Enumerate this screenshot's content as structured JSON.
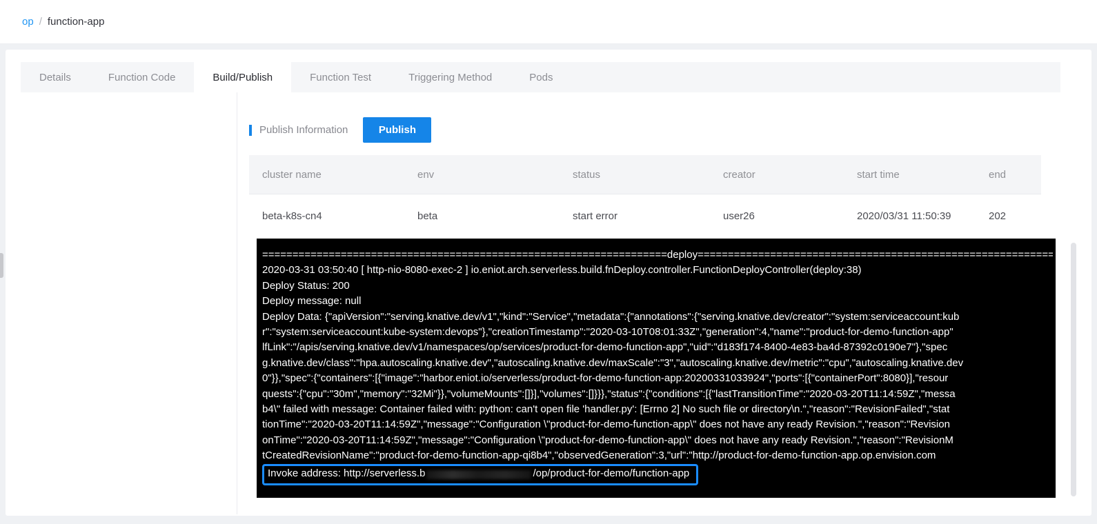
{
  "breadcrumb": {
    "root": "op",
    "separator": "/",
    "current": "function-app"
  },
  "tabs": [
    {
      "label": "Details",
      "active": false
    },
    {
      "label": "Function Code",
      "active": false
    },
    {
      "label": "Build/Publish",
      "active": true
    },
    {
      "label": "Function Test",
      "active": false
    },
    {
      "label": "Triggering Method",
      "active": false
    },
    {
      "label": "Pods",
      "active": false
    }
  ],
  "publish_section": {
    "title": "Publish Information",
    "publish_button": "Publish"
  },
  "table": {
    "columns": [
      "cluster name",
      "env",
      "status",
      "creator",
      "start time",
      "end"
    ],
    "row": [
      "beta-k8s-cn4",
      "beta",
      "start error",
      "user26",
      "2020/03/31 11:50:39",
      "202"
    ]
  },
  "terminal": {
    "lines": [
      "===================================================================deploy===========================================================================",
      "2020-03-31 03:50:40 [ http-nio-8080-exec-2 ] io.eniot.arch.serverless.build.fnDeploy.controller.FunctionDeployController(deploy:38)",
      "Deploy Status: 200",
      "Deploy message: null",
      "Deploy Data: {\"apiVersion\":\"serving.knative.dev/v1\",\"kind\":\"Service\",\"metadata\":{\"annotations\":{\"serving.knative.dev/creator\":\"system:serviceaccount:kub",
      "r\":\"system:serviceaccount:kube-system:devops\"},\"creationTimestamp\":\"2020-03-10T08:01:33Z\",\"generation\":4,\"name\":\"product-for-demo-function-app\"",
      "lfLink\":\"/apis/serving.knative.dev/v1/namespaces/op/services/product-for-demo-function-app\",\"uid\":\"d183f174-8400-4e83-ba4d-87392c0190e7\"},\"spec",
      "g.knative.dev/class\":\"hpa.autoscaling.knative.dev\",\"autoscaling.knative.dev/maxScale\":\"3\",\"autoscaling.knative.dev/metric\":\"cpu\",\"autoscaling.knative.dev",
      "0\"}},\"spec\":{\"containers\":[{\"image\":\"harbor.eniot.io/serverless/product-for-demo-function-app:20200331033924\",\"ports\":[{\"containerPort\":8080}],\"resour",
      "quests\":{\"cpu\":\"30m\",\"memory\":\"32Mi\"}},\"volumeMounts\":[]}],\"volumes\":[]}}},\"status\":{\"conditions\":[{\"lastTransitionTime\":\"2020-03-20T11:14:59Z\",\"messa",
      "b4\\\" failed with message: Container failed with: python: can't open file 'handler.py': [Errno 2] No such file or directory\\n.\",\"reason\":\"RevisionFailed\",\"stat",
      "tionTime\":\"2020-03-20T11:14:59Z\",\"message\":\"Configuration \\\"product-for-demo-function-app\\\" does not have any ready Revision.\",\"reason\":\"Revision",
      "onTime\":\"2020-03-20T11:14:59Z\",\"message\":\"Configuration \\\"product-for-demo-function-app\\\" does not have any ready Revision.\",\"reason\":\"RevisionM",
      "tCreatedRevisionName\":\"product-for-demo-function-app-qi8b4\",\"observedGeneration\":3,\"url\":\"http://product-for-demo-function-app.op.envision.com"
    ],
    "invoke": {
      "prefix": "Invoke address: http://serverless.b",
      "suffix": "/op/product-for-demo/function-app"
    }
  },
  "colors": {
    "accent_blue": "#1585e8",
    "link_blue": "#2196f3",
    "highlight_border": "#1a8cff",
    "terminal_bg": "#000000",
    "terminal_text": "#ffffff",
    "tabbar_bg": "#f5f6f8",
    "table_header_bg": "#f4f5f7"
  }
}
